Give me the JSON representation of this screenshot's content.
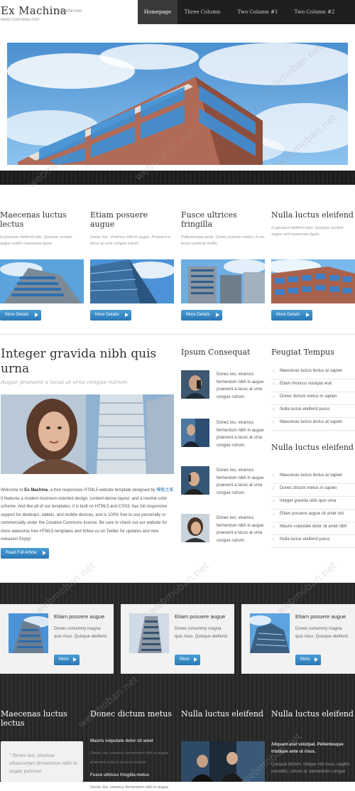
{
  "header": {
    "logo_title": "Ex Machina",
    "logo_sub": "colorful.com",
    "logo_url": "www.cssmoban.com",
    "nav": [
      "Homepage",
      "Three Column",
      "Two Column #1",
      "Two Column #2"
    ]
  },
  "features": [
    {
      "title": "Maecenas luctus lectus",
      "text": "In posuere eleifend odio. Quisque semper augue mattis maecenas ligula.",
      "button": "More Details"
    },
    {
      "title": "Etiam posuere augue",
      "text": "Donec leo. Vivamus nibh in augue. Praesent a lacus at urna congue rutrum.",
      "button": "More Details"
    },
    {
      "title": "Fusce ultrices fringilla",
      "text": "Pellentesque pede. Donec pulvinar metus. In eu lectus pulvinar mollis.",
      "button": "More Details"
    },
    {
      "title": "Nulla luctus eleifend",
      "text": "In posuere eleifend odio. Quisque semper augue sed maecenas ligula.",
      "button": "More Details"
    }
  ],
  "article": {
    "title": "Integer gravida nibh quis urna",
    "subtitle": "Augue praesent a lacus at urna congue rutrum",
    "body_p1": "Welcome to ",
    "body_brand": "Ex Machina",
    "body_p2": ", a free responsive HTML5 website template designed by ",
    "body_link": "模板之家",
    "body_p3": ". It features a modern business-oriented design, content-dense layout, and a neutral color scheme. And like all of our templates, it is built on HTML5 and CSS3, has full responsive support for desktops, tablets, and mobile devices, and is 100% free to use personally or commercially under the Creative Commons license. Be sure to check out our website for more awesome free HTML5 templates and follow us on Twitter for updates and new releases! Enjoy!",
    "button": "Read Full Article"
  },
  "middle": {
    "title": "Ipsum Consequat",
    "items": [
      "Donec leo, vivamus fermentum nibh in augue praesent a lacus at urna congue rutrum.",
      "Donec leo, vivamus fermentum nibh in augue praesent a lacus at urna congue rutrum.",
      "Donec leo, vivamus fermentum nibh in augue praesent a lacus at urna congue rutrum.",
      "Donec leo, vivamus fermentum nibh in augue praesent a lacus at urna congue rutrum."
    ]
  },
  "right": {
    "title1": "Feugiat Tempus",
    "list1": [
      "Maecenas luctus lectus at sapien",
      "Etiam rhoncus volutpat erat",
      "Donec dictum metus in sapien",
      "Nulla luctus eleifend purus",
      "Maecenas luctus lectus at sapien"
    ],
    "title2": "Nulla luctus eleifend",
    "list2": [
      "Maecenas luctus lectus at sapien",
      "Donec dictum metus in sapien",
      "Integer gravida nibh quis urna",
      "Etiam posuere augue sit amet nisi",
      "Mauris vulputate dolor sit amet nibh",
      "Nulla luctus eleifend purus"
    ]
  },
  "cards": [
    {
      "title": "Etiam posuere augue",
      "text": "Donec nonummy magna quis risus. Quisque eleifend.",
      "button": "More"
    },
    {
      "title": "Etiam posuere augue",
      "text": "Donec nonummy magna quis risus. Quisque eleifend.",
      "button": "More"
    },
    {
      "title": "Etiam posuere augue",
      "text": "Donec nonummy magna quis risus. Quisque eleifend.",
      "button": "More"
    }
  ],
  "footer": {
    "titles": [
      "Maecenas luctus lectus",
      "Donec dictum metus",
      "Nulla luctus eleifend",
      "Nulla luctus eleifend"
    ],
    "quote": "“ Donec leo, vivamus ullamcorper fermentum nibh in augue pulvinar",
    "mid1_title": "Mauris vulputate dolor sit amet",
    "mid1_text": "Donec leo, vivamus fermentum nibh in augue praesent a lacus at urna congue",
    "mid2_title": "Fusce ultrices fringilla metus",
    "mid2_text": "Donec leo, vivamus fermentum nibh in augue",
    "right_title": "Aliquam erat volutpat. Pellentesque tristique ante ut risus.",
    "right_text": "Quisque dictum. Integer nisl risus, sagittis convallis, rutrum id, elementum congue"
  },
  "watermark": "webmoban.net",
  "colors": {
    "accent": "#2a77b4",
    "dark_band": "#262626",
    "nav_bg": "#1f1f1f"
  }
}
